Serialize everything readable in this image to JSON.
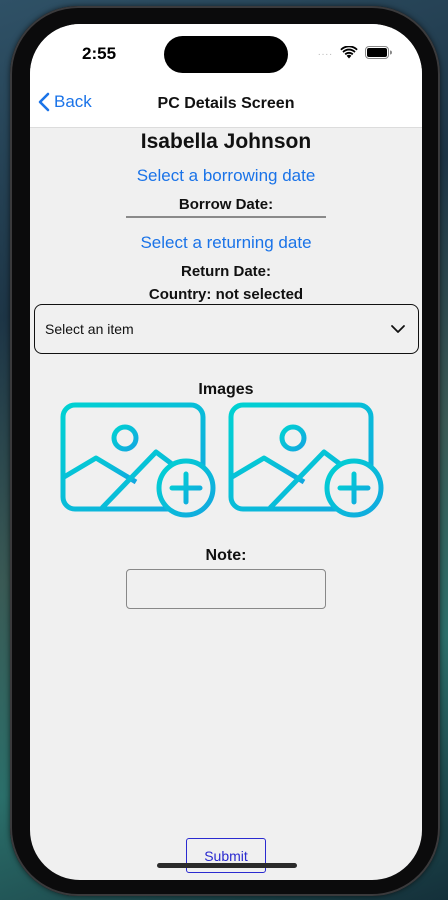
{
  "status_bar": {
    "time": "2:55",
    "signal": "...."
  },
  "nav": {
    "back_label": "Back",
    "title": "PC Details Screen"
  },
  "form": {
    "name": "Isabella Johnson",
    "borrow_link": "Select a borrowing date",
    "borrow_label": "Borrow Date:",
    "return_link": "Select a returning date",
    "return_label": "Return Date:",
    "country_label": "Country: not selected",
    "dropdown_placeholder": "Select an item",
    "images_label": "Images",
    "note_label": "Note:",
    "note_value": "",
    "submit_label": "Submit"
  },
  "colors": {
    "link": "#1a73e8",
    "icon_gradient_start": "#00d2d2",
    "icon_gradient_end": "#12a7e0",
    "submit": "#2a2ad0"
  },
  "icons": [
    "chevron-left-icon",
    "wifi-icon",
    "battery-icon",
    "chevron-down-icon",
    "add-image-icon"
  ]
}
